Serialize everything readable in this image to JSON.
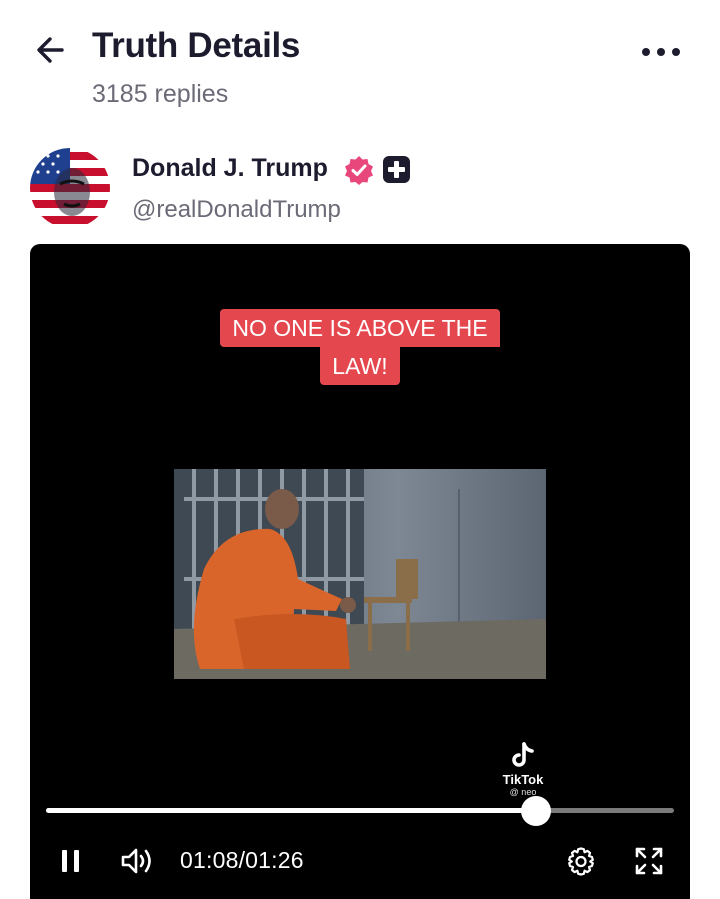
{
  "header": {
    "title": "Truth Details",
    "replies": "3185 replies",
    "back_icon": "arrow-left-icon",
    "more_icon": "more-horizontal-icon"
  },
  "author": {
    "name": "Donald J. Trump",
    "handle": "@realDonaldTrump",
    "verified_icon": "verified-badge-icon",
    "plus_icon": "plus-badge-icon",
    "verified_color": "#e8477c"
  },
  "video": {
    "caption_line1": "NO ONE IS ABOVE THE",
    "caption_line2": "LAW!",
    "caption_color": "#e4484e",
    "watermark_brand": "TikTok",
    "watermark_user": "@ neo",
    "current_time": "01:08",
    "time_separator": "/",
    "duration": "01:26",
    "progress_fraction": 0.78
  },
  "controls": {
    "pause_icon": "pause-icon",
    "volume_icon": "volume-icon",
    "settings_icon": "gear-icon",
    "fullscreen_icon": "fullscreen-icon"
  }
}
